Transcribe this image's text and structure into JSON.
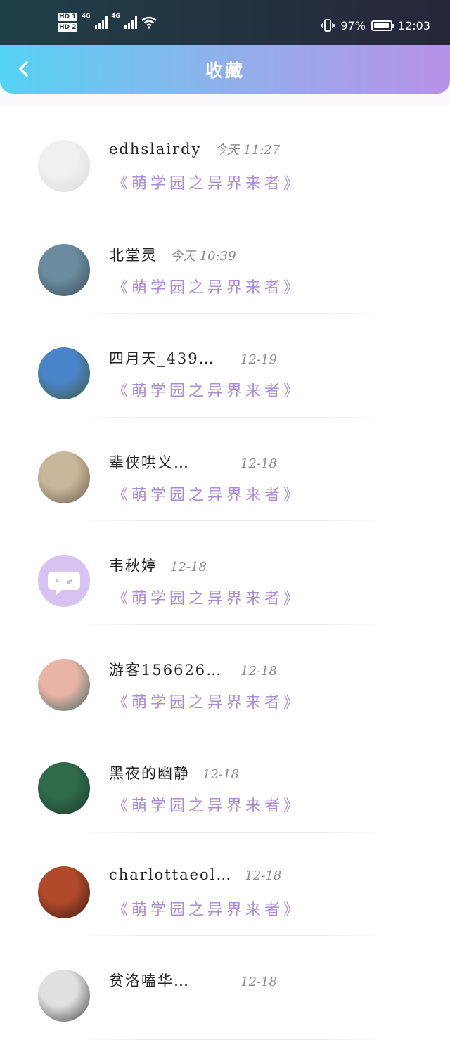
{
  "status_bar": {
    "hd1": "HD 1",
    "hd2": "HD 2",
    "net1": "4G",
    "net2": "4G",
    "battery_text": "97%",
    "battery_level": 0.97,
    "time": "12:03"
  },
  "header": {
    "title": "收藏"
  },
  "favorites": [
    {
      "name": "edhslairdy",
      "time": "今天  11:27",
      "book": "《萌学园之异界来者》",
      "avatar_colors": [
        "#f0f0f0",
        "#d8d8d8"
      ]
    },
    {
      "name": "北堂灵",
      "time": "今天  10:39",
      "book": "《萌学园之异界来者》",
      "avatar_colors": [
        "#6a8c9e",
        "#3b4a58"
      ]
    },
    {
      "name": "四月天_439…",
      "time": "12-19",
      "book": "《萌学园之异界来者》",
      "avatar_colors": [
        "#4a84c8",
        "#3d5a3a"
      ]
    },
    {
      "name": "辈侠哄义…",
      "time": "12-18",
      "book": "《萌学园之异界来者》",
      "avatar_colors": [
        "#c9b79c",
        "#6b5a48"
      ]
    },
    {
      "name": "韦秋婷",
      "time": "12-18",
      "book": "《萌学园之异界来者》",
      "avatar_colors": [
        "#d7c2f2",
        "#d7c2f2"
      ]
    },
    {
      "name": "游客156626…",
      "time": "12-18",
      "book": "《萌学园之异界来者》",
      "avatar_colors": [
        "#e9b4a8",
        "#3a6a5c"
      ]
    },
    {
      "name": "黑夜的幽静",
      "time": "12-18",
      "book": "《萌学园之异界来者》",
      "avatar_colors": [
        "#2f6a4a",
        "#1a3a2a"
      ]
    },
    {
      "name": "charlottaeol…",
      "time": "12-18",
      "book": "《萌学园之异界来者》",
      "avatar_colors": [
        "#b04a2a",
        "#3a1a10"
      ]
    },
    {
      "name": "贫洛嗑华…",
      "time": "12-18",
      "book": "",
      "avatar_colors": [
        "#e0e0e0",
        "#404040"
      ]
    }
  ]
}
